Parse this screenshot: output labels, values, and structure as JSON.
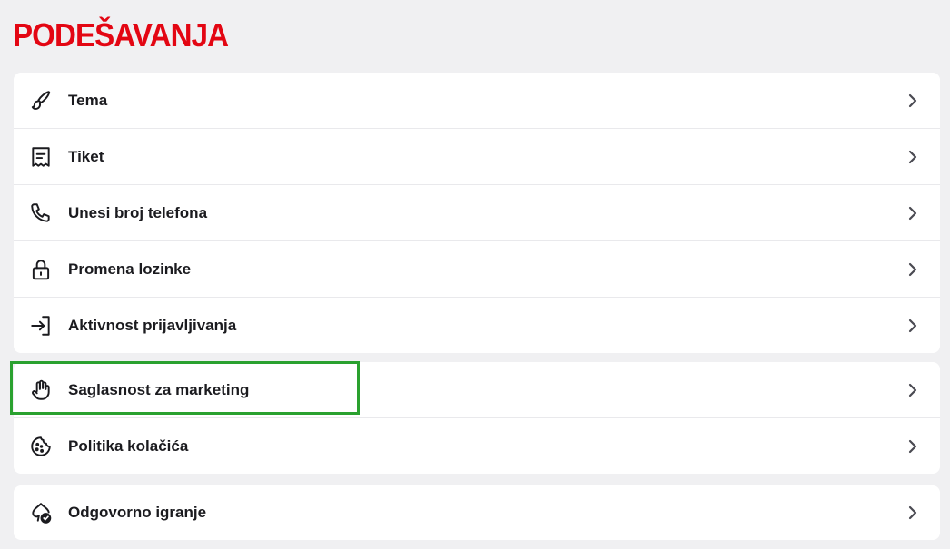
{
  "page": {
    "title": "PODEŠAVANJA"
  },
  "groups": [
    {
      "items": [
        {
          "label": "Tema",
          "icon": "brush-icon"
        },
        {
          "label": "Tiket",
          "icon": "receipt-icon"
        },
        {
          "label": "Unesi broj telefona",
          "icon": "phone-icon"
        },
        {
          "label": "Promena lozinke",
          "icon": "lock-icon"
        },
        {
          "label": "Aktivnost prijavljivanja",
          "icon": "login-icon"
        }
      ]
    },
    {
      "items": [
        {
          "label": "Saglasnost za marketing",
          "icon": "hand-icon"
        },
        {
          "label": "Politika kolačića",
          "icon": "cookie-icon"
        }
      ]
    },
    {
      "items": [
        {
          "label": "Odgovorno igranje",
          "icon": "responsible-gaming-icon"
        }
      ]
    }
  ],
  "colors": {
    "brand": "#e30613",
    "highlight": "#2aa12f",
    "background": "#f0f0f2"
  }
}
